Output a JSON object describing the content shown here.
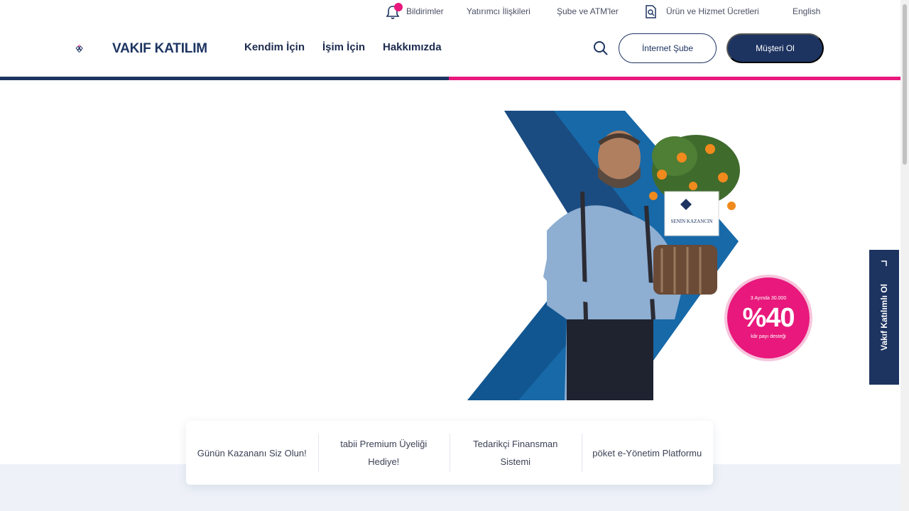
{
  "utility": {
    "notifications": "Bildirimler",
    "investor_relations": "Yatırımcı İlişkileri",
    "branch_atm": "Şube ve ATM'ler",
    "fees": "Ürün ve Hizmet Ücretleri",
    "language": "English"
  },
  "header": {
    "logo_text": "VAKIF KATILIM",
    "nav": [
      "Kendim İçin",
      "İşim İçin",
      "Hakkımızda"
    ],
    "internet_branch": "İnternet Şube",
    "become_customer": "Müşteri Ol"
  },
  "hero": {
    "badge_top": "3 Ayında 30.000",
    "badge_main": "%40",
    "badge_bottom": "kâr payı desteği",
    "sign_text": "SENİN KAZANCIN"
  },
  "side_tab": {
    "label": "Vakıf Katılımlı Ol"
  },
  "cards": [
    "Günün Kazananı Siz Olun!",
    "tabii Premium Üyeliği Hediye!",
    "Tedarikçi Finansman Sistemi",
    "pöket e-Yönetim Platformu"
  ],
  "colors": {
    "brand_navy": "#1d3461",
    "brand_pink": "#e8187c",
    "hero_blue": "#1769a8"
  }
}
